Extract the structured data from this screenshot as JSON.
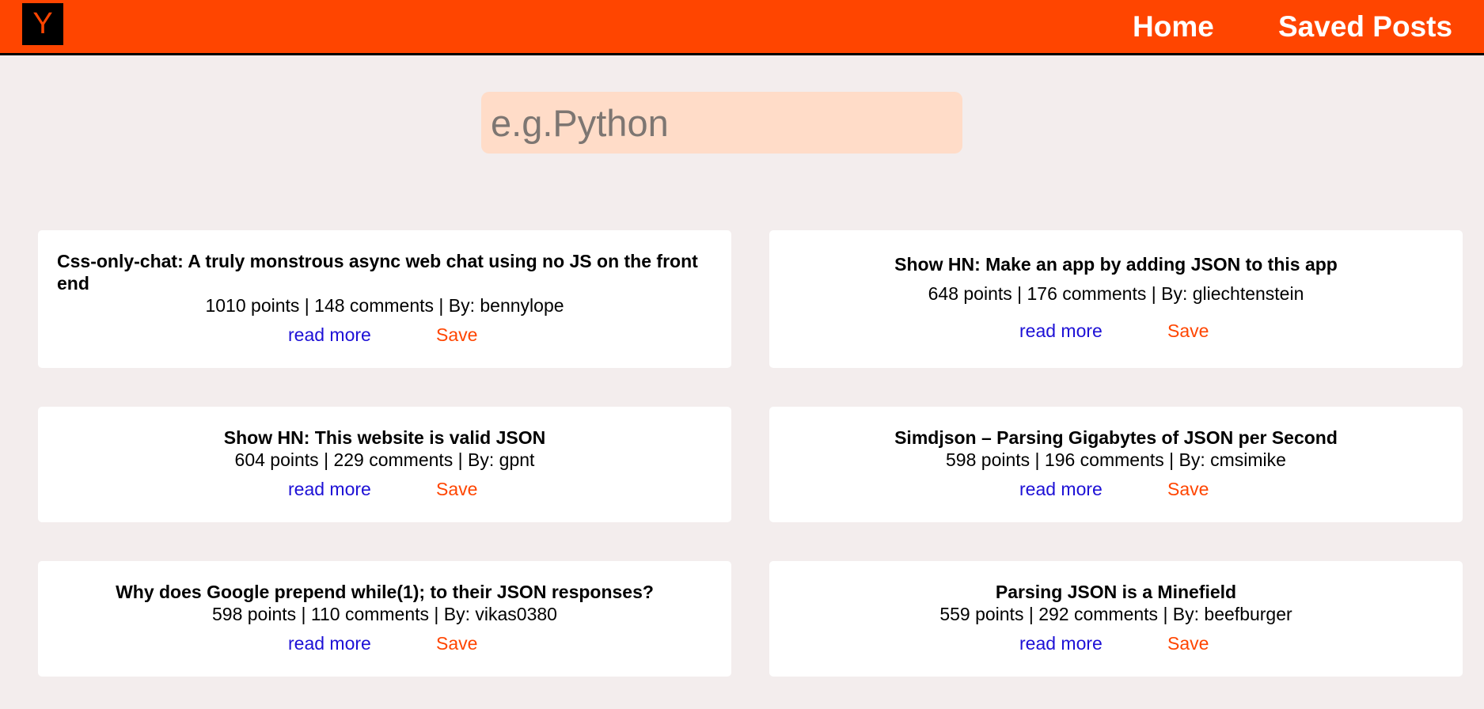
{
  "nav": {
    "logo_letter": "Y",
    "home_label": "Home",
    "saved_label": "Saved Posts"
  },
  "search": {
    "placeholder": "e.g.Python",
    "value": ""
  },
  "posts": [
    {
      "title": "Css-only-chat: A truly monstrous async web chat using no JS on the front end",
      "meta": "1010 points | 148 comments | By: bennylope",
      "read_more": "read more",
      "save": "Save"
    },
    {
      "title": "Show HN: Make an app by adding JSON to this app",
      "meta": "648 points | 176 comments | By: gliechtenstein",
      "read_more": "read more",
      "save": "Save"
    },
    {
      "title": "Show HN: This website is valid JSON",
      "meta": "604 points | 229 comments | By: gpnt",
      "read_more": "read more",
      "save": "Save"
    },
    {
      "title": "Simdjson – Parsing Gigabytes of JSON per Second",
      "meta": "598 points | 196 comments | By: cmsimike",
      "read_more": "read more",
      "save": "Save"
    },
    {
      "title": "Why does Google prepend while(1); to their JSON responses?",
      "meta": "598 points | 110 comments | By: vikas0380",
      "read_more": "read more",
      "save": "Save"
    },
    {
      "title": "Parsing JSON is a Minefield",
      "meta": "559 points | 292 comments | By: beefburger",
      "read_more": "read more",
      "save": "Save"
    }
  ],
  "colors": {
    "accent": "#ff4500",
    "background": "#f3eded",
    "search_bg": "#ffdcc8",
    "link": "#1d10d6"
  }
}
